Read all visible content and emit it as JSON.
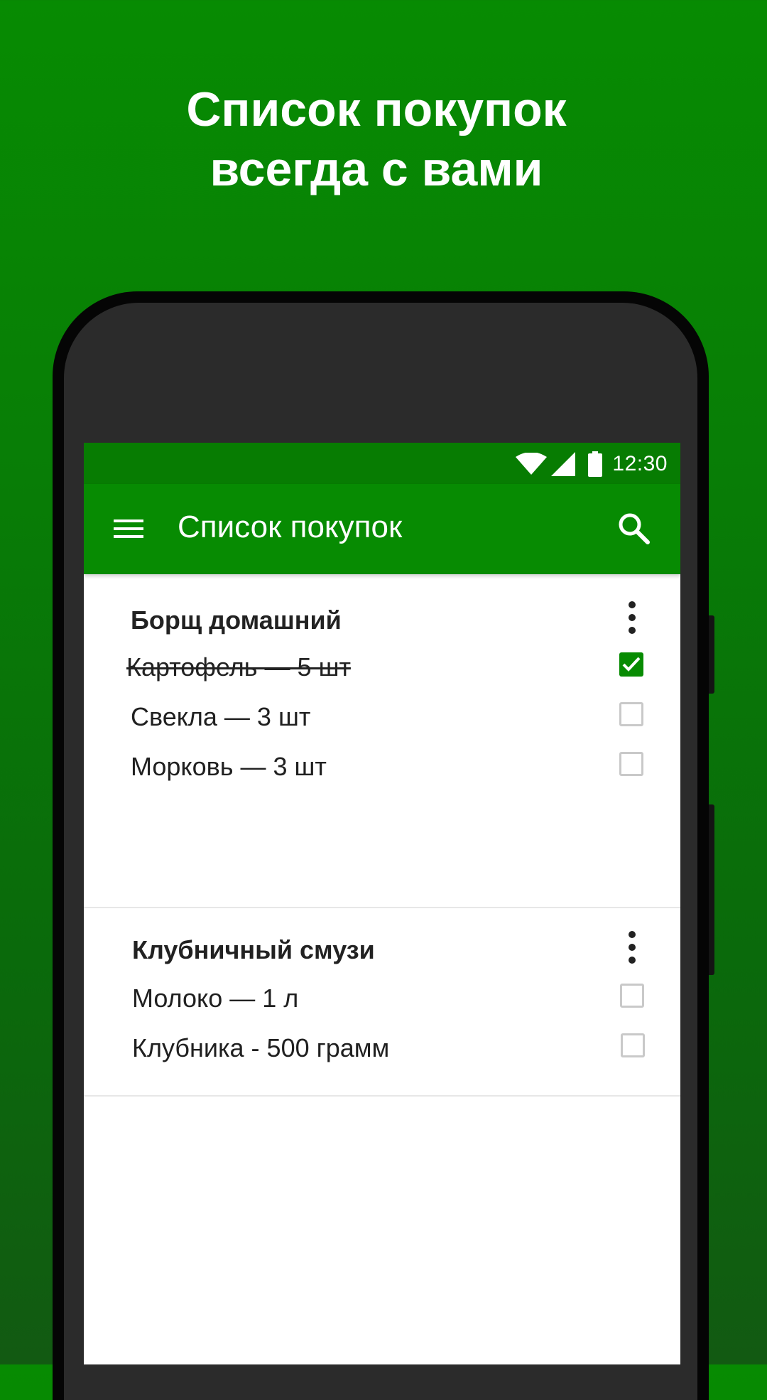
{
  "headline": {
    "line1": "Список покупок",
    "line2": "всегда с вами"
  },
  "status_bar": {
    "time": "12:30"
  },
  "app_bar": {
    "title": "Список покупок"
  },
  "lists": [
    {
      "title": "Борщ домашний",
      "items": [
        {
          "text": "Картофель — 5 шт",
          "checked": true
        },
        {
          "text": "Свекла — 3 шт",
          "checked": false
        },
        {
          "text": "Морковь — 3 шт",
          "checked": false
        }
      ]
    },
    {
      "title": "Клубничный смузи",
      "items": [
        {
          "text": "Молоко — 1 л",
          "checked": false
        },
        {
          "text": "Клубника - 500 грамм",
          "checked": false
        }
      ]
    }
  ],
  "colors": {
    "brand_green": "#078b02",
    "status_green": "#077c02",
    "checkbox_off": "#c9c9c9"
  },
  "icons": {
    "menu": "hamburger-icon",
    "search": "search-icon",
    "more": "more-vertical-icon",
    "wifi": "wifi-icon",
    "signal": "cell-signal-icon",
    "battery": "battery-icon",
    "check": "check-icon"
  }
}
